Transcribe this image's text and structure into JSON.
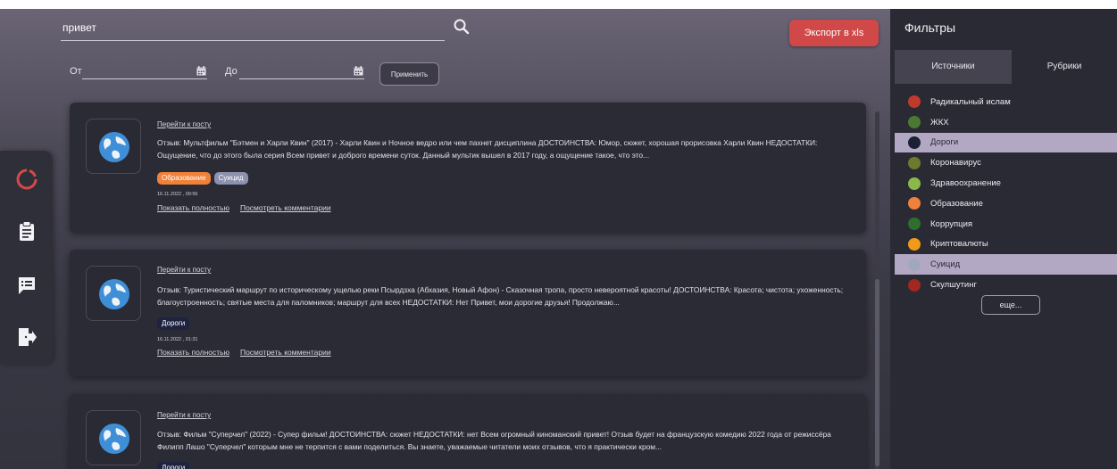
{
  "search": {
    "value": "привет",
    "export_label": "Экспорт в xls"
  },
  "dates": {
    "from_label": "От",
    "to_label": "До",
    "apply_label": "Применить"
  },
  "nav": {
    "icons": [
      "logo-ring-icon",
      "clipboard-icon",
      "comments-icon",
      "exit-icon"
    ],
    "accent_color": "#d44a4a"
  },
  "posts": [
    {
      "link": "Перейти к посту",
      "text": "Отзыв: Мультфильм \"Бэтмен и Харли Квин\" (2017) - Харли Квин и Ночное ведро или чем пахнет дисциплина ДОСТОИНСТВА: Юмор, сюжет, хорошая прорисовка Харли Квин НЕДОСТАТКИ: Ощущение, что до этого была серия Всем привет и доброго времени суток. Данный мультик вышел в 2017 году, а ощущение такое, что это...",
      "tags": [
        {
          "label": "Образование",
          "color": "#f0813a"
        },
        {
          "label": "Суицид",
          "color": "#8c92ad"
        }
      ],
      "date": "16.11.2022 , 09:56",
      "show_full": "Показать полностью",
      "show_comments": "Посмотреть комментарии"
    },
    {
      "link": "Перейти к посту",
      "text": "Отзыв: Туристический маршрут по историческому ущелью реки Псырдзха (Абхазия, Новый Афон) - Сказочная тропа, просто невероятной красоты! ДОСТОИНСТВА: Красота; чистота; ухоженность; благоустроенность; святые места для паломников; маршрут для всех НЕДОСТАТКИ: Нет Привет, мои дорогие друзья! Продолжаю...",
      "tags": [
        {
          "label": "Дороги",
          "color": "#1d2340"
        }
      ],
      "date": "16.11.2022 , 01:31",
      "show_full": "Показать полностью",
      "show_comments": "Посмотреть комментарии"
    },
    {
      "link": "Перейти к посту",
      "text": "Отзыв: Фильм \"Суперчел\" (2022) - Супер фильм! ДОСТОИНСТВА: сюжет НЕДОСТАТКИ: нет Всем огромный киноманский привет! Отзыв будет на французскую комедию 2022 года от режиссёра Филипп Лашо \"Суперчел\" которым мне не терпится с вами поделиться. Вы знаете, уважаемые читатели моих отзывов, что я практически кром...",
      "tags": [
        {
          "label": "Дороги",
          "color": "#1d2340"
        }
      ]
    }
  ],
  "filters": {
    "title": "Фильтры",
    "tabs": [
      {
        "label": "Источники",
        "active": true
      },
      {
        "label": "Рубрики",
        "active": false
      }
    ],
    "items": [
      {
        "label": "Радикальный ислам",
        "color": "#c0392b",
        "selected": false
      },
      {
        "label": "ЖКХ",
        "color": "#4a7a32",
        "selected": false
      },
      {
        "label": "Дороги",
        "color": "#1b2035",
        "selected": true
      },
      {
        "label": "Коронавирус",
        "color": "#6b7a2e",
        "selected": false
      },
      {
        "label": "Здравоохранение",
        "color": "#8bb84a",
        "selected": false
      },
      {
        "label": "Образование",
        "color": "#f0813a",
        "selected": false
      },
      {
        "label": "Коррупция",
        "color": "#2e6e2e",
        "selected": false
      },
      {
        "label": "Криптовалюты",
        "color": "#f09a1a",
        "selected": false
      },
      {
        "label": "Суицид",
        "color": "#a0a8c0",
        "selected": true
      },
      {
        "label": "Скулшутинг",
        "color": "#a0281e",
        "selected": false
      }
    ],
    "more_label": "еще..."
  }
}
